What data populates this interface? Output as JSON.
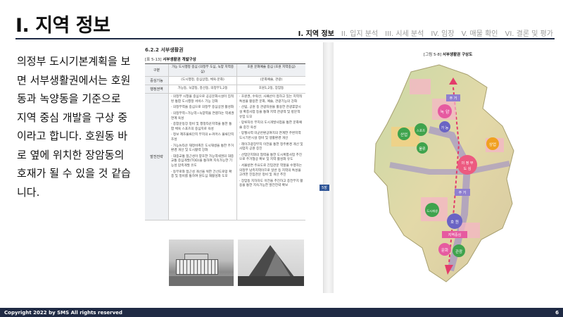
{
  "header": {
    "title": "I. 지역 정보",
    "nav": [
      {
        "label": "I. 지역 정보",
        "active": true
      },
      {
        "label": "II. 입지 분석",
        "active": false
      },
      {
        "label": "III. 시세 분석",
        "active": false
      },
      {
        "label": "IV. 임장",
        "active": false
      },
      {
        "label": "V. 매물 확인",
        "active": false
      },
      {
        "label": "VI. 결론 및 평가",
        "active": false
      }
    ]
  },
  "body_text": "의정부 도시기본계획을 보면 서부생활권에서는 호원동과 녹양동을 기준으로 지역 중심 개발을 구상 중이라고 합니다. 호원동 바로 옆에 위치한 장암동의 호재가 될 수 있을 것 같습니다.",
  "document": {
    "section_title": "6.2.2 서부생활권",
    "table_caption_prefix": "[표 5-13]",
    "table_caption_title": "서부생활권 개발구상",
    "table": {
      "col0_header": "구분",
      "col1_header": "가능 도시행정 중심 (의정부 도심, 녹양 지역중심)",
      "col2_header": "호원 문화예술 중심 (호원 지역중심)",
      "row_function": {
        "label": "중심기능",
        "c1": "(도시행정, 중심상업, 체육·문화)",
        "c2": "(문화예술, 관광)"
      },
      "row_area": {
        "label": "행정권역",
        "c1": "가능동, 녹양동, 흥선동, 의정부1,2동",
        "c2": "호원1,2동, 장암동"
      },
      "row_strategy_label": "발전전략",
      "c1_bullets": [
        "· 의정부 시청을 중심으로 공공문화시설이 집적된 통합 도시행정 서비스 기능 강화",
        "· 의정부역을 중심으로 의정부 중심상권 활성화",
        "· 의정부역~가능역~녹양역을 연결하는 역세권 연계 육성",
        "· 종합운동장 정비 및 행정타운지역을 통한 통합 체육 스포츠의 중심지로 육성",
        "· 정보 제조물류단지 부지의 e-커머스 물류단지 조성",
        "· 가능뉴타운 재정비촉진 도시재생을 통한 주거환경 개선 및 도시활력 강화",
        "· 대중교통 접근성이 양호한 가능역세권의 대중교통 중심개발(TOD)을 통하여 지속가능한 기능성 압축개발 유도",
        "· 동부로와 접근성 개선을 위한 간선도로망 확충 및 정비를 통하여 원도심 재활성화 도모"
      ],
      "c2_bullets": [
        "· 호원권, 수락산, 사패산이 접하고 있는 지역적 특성을 활용한 문화, 예술, 관광기능의 강화",
        "· 산림, 공원 등 관광자원을 활용한 관광휴양시설 확충사업 등을 통해 지역 관광객 및 방문객 유입 도모",
        "· 망루자유 부지의 도시개발사업을 통한 문화예술 중진 육성",
        "· 망월사역 미군반환공여지의 연계한 주변지역 도시기반시설 정비 및 생활환경 개선",
        "· 레이크광장부지 이전을 통한 정주환경 개선 및 사업지 공원 증진",
        "· 산업단지와의 협력을 통한 도시복합사업 추진으로 주거형상 확보 및 지역 활성화 유도",
        "· 서울방면 주요도로 진입관문 역할을 수행하는 의정부 남측지역이므로 일반 등 지역의 특성을 고려한 진입관문 정비 및 개선 추진",
        "· 장암동 지하차도 이전을 추진하고 종전부지 활용을 통한 지속가능한 발전전략 확보"
      ]
    },
    "page_tab": "5장",
    "figure_caption_prefix": "[그림 5-8]",
    "figure_caption_title": "서부생활권 구상도",
    "map_labels": {
      "a": "녹 양",
      "b": "가 능",
      "c": "산업",
      "d": "스포츠",
      "e": "물류",
      "f": "의 정 부",
      "g": "도 심",
      "h": "상업",
      "i": "주 거",
      "j": "도시재생",
      "k": "호 원",
      "l": "지역중심",
      "m": "문화",
      "n": "관광",
      "o": "주 거"
    }
  },
  "footer": {
    "copyright": "Copyright 2022 by SMS All rights reserved",
    "page_number": "6"
  },
  "colors": {
    "navy": "#1f2a44",
    "nav_inactive": "#9a9a9a"
  }
}
